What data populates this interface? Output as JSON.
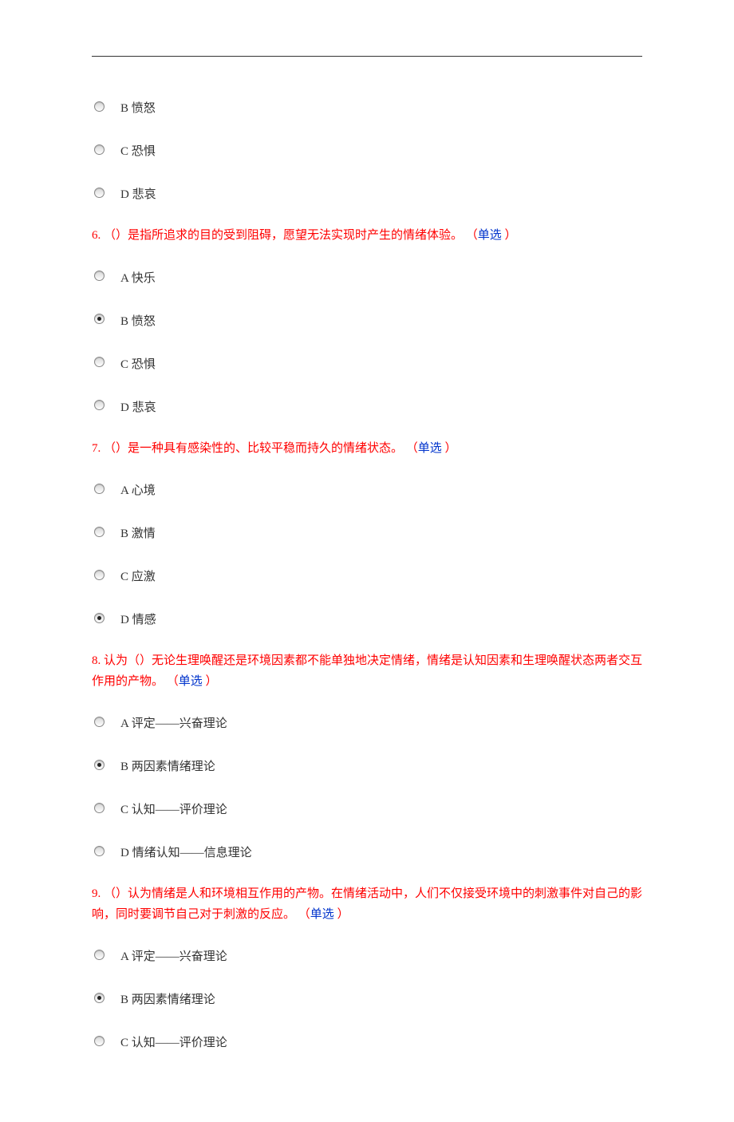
{
  "orphan_options": [
    {
      "label": "B",
      "text": "愤怒",
      "selected": false
    },
    {
      "label": "C",
      "text": "恐惧",
      "selected": false
    },
    {
      "label": "D",
      "text": "悲哀",
      "selected": false
    }
  ],
  "questions": [
    {
      "number": "6.",
      "text": "（）是指所追求的目的受到阻碍，愿望无法实现时产生的情绪体验。",
      "type_label": "单选",
      "options": [
        {
          "label": "A",
          "text": "快乐",
          "selected": false
        },
        {
          "label": "B",
          "text": "愤怒",
          "selected": true
        },
        {
          "label": "C",
          "text": "恐惧",
          "selected": false
        },
        {
          "label": "D",
          "text": "悲哀",
          "selected": false
        }
      ]
    },
    {
      "number": "7.",
      "text": "（）是一种具有感染性的、比较平稳而持久的情绪状态。",
      "type_label": "单选",
      "options": [
        {
          "label": "A",
          "text": "心境",
          "selected": false
        },
        {
          "label": "B",
          "text": "激情",
          "selected": false
        },
        {
          "label": "C",
          "text": "应激",
          "selected": false
        },
        {
          "label": "D",
          "text": "情感",
          "selected": true
        }
      ]
    },
    {
      "number": "8.",
      "text": "认为（）无论生理唤醒还是环境因素都不能单独地决定情绪，情绪是认知因素和生理唤醒状态两者交互作用的产物。",
      "type_label": "单选",
      "options": [
        {
          "label": "A",
          "text": "评定——兴奋理论",
          "selected": false
        },
        {
          "label": "B",
          "text": "两因素情绪理论",
          "selected": true
        },
        {
          "label": "C",
          "text": "认知——评价理论",
          "selected": false
        },
        {
          "label": "D",
          "text": "情绪认知——信息理论",
          "selected": false
        }
      ]
    },
    {
      "number": "9.",
      "text": "（）认为情绪是人和环境相互作用的产物。在情绪活动中，人们不仅接受环境中的刺激事件对自己的影响，同时要调节自己对于刺激的反应。",
      "type_label": "单选",
      "options": [
        {
          "label": "A",
          "text": "评定——兴奋理论",
          "selected": false
        },
        {
          "label": "B",
          "text": "两因素情绪理论",
          "selected": true
        },
        {
          "label": "C",
          "text": "认知——评价理论",
          "selected": false
        }
      ]
    }
  ]
}
